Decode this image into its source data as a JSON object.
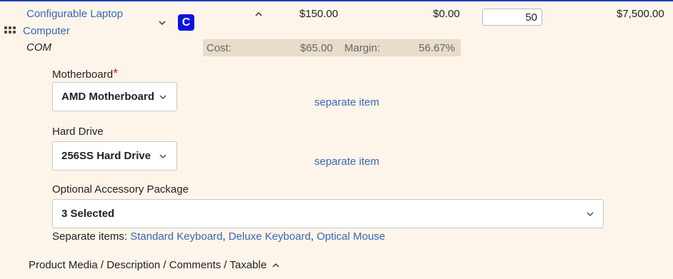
{
  "product": {
    "name_line1": "Configurable Laptop",
    "name_line2": "Computer",
    "sku": "COM",
    "type_badge": "C",
    "unit_price": "$150.00",
    "discount": "$0.00",
    "quantity": "50",
    "line_total": "$7,500.00"
  },
  "cost_info": {
    "cost_label": "Cost:",
    "cost_value": "$65.00",
    "margin_label": "Margin:",
    "margin_value": "56.67%"
  },
  "options": {
    "motherboard": {
      "label": "Motherboard",
      "required_mark": "*",
      "selected": "AMD Motherboard",
      "link": "separate item"
    },
    "hard_drive": {
      "label": "Hard Drive",
      "selected": "256SS Hard Drive",
      "link": "separate item"
    },
    "accessory": {
      "label": "Optional Accessory Package",
      "selected": "3 Selected",
      "separate_items_label": "Separate items:",
      "items": [
        "Standard Keyboard",
        "Deluxe Keyboard",
        "Optical Mouse"
      ]
    }
  },
  "footer": {
    "sections_label": "Product Media / Description / Comments / Taxable"
  },
  "icons": {
    "drag": "drag-handle-icon",
    "expand": "chevron-down-icon",
    "collapse": "chevron-up-icon"
  },
  "colors": {
    "accent_top_border": "#1f3fbf",
    "badge": "#0a14e0",
    "link": "#3a66b7",
    "background": "#fdf5ea",
    "cost_bar": "#e8dccb",
    "required": "#d42020"
  }
}
